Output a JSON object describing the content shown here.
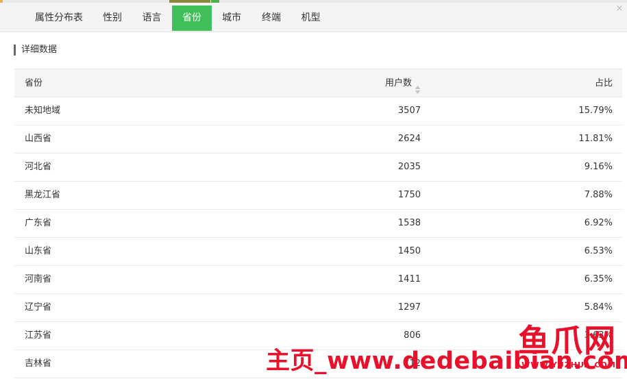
{
  "tabs": [
    {
      "label": "属性分布表",
      "active": false
    },
    {
      "label": "性别",
      "active": false
    },
    {
      "label": "语言",
      "active": false
    },
    {
      "label": "省份",
      "active": true
    },
    {
      "label": "城市",
      "active": false
    },
    {
      "label": "终端",
      "active": false
    },
    {
      "label": "机型",
      "active": false
    }
  ],
  "close_label": "×",
  "section_title": "详细数据",
  "table": {
    "headers": [
      "省份",
      "用户数",
      "占比"
    ],
    "rows": [
      [
        "未知地域",
        "3507",
        "15.79%"
      ],
      [
        "山西省",
        "2624",
        "11.81%"
      ],
      [
        "河北省",
        "2035",
        "9.16%"
      ],
      [
        "黑龙江省",
        "1750",
        "7.88%"
      ],
      [
        "广东省",
        "1538",
        "6.92%"
      ],
      [
        "山东省",
        "1450",
        "6.53%"
      ],
      [
        "河南省",
        "1411",
        "6.35%"
      ],
      [
        "辽宁省",
        "1297",
        "5.84%"
      ],
      [
        "江苏省",
        "806",
        "3.63%"
      ],
      [
        "吉林省",
        "712",
        ""
      ]
    ]
  },
  "watermark": {
    "text": "主页_www.dedebaibian.com",
    "logo_text": "鱼爪网",
    "logo_sub": "WWW.YUZHUA.COM"
  },
  "colors": {
    "active_tab": "#3fbe5a",
    "watermark": "#e8102a"
  }
}
